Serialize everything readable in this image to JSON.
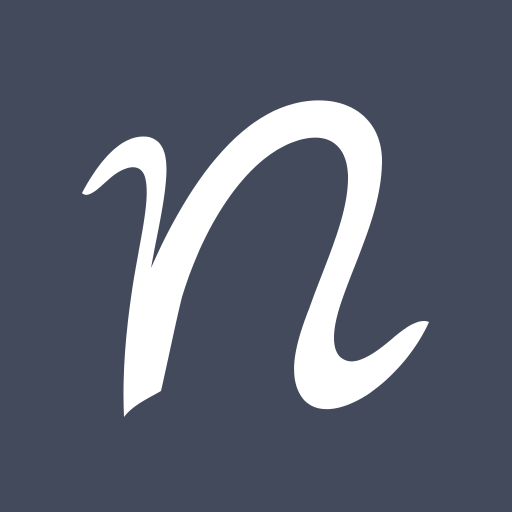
{
  "icon": {
    "name": "n-logo-icon",
    "letter": "n",
    "background_color": "#434a5c",
    "glyph_color": "#ffffff"
  }
}
